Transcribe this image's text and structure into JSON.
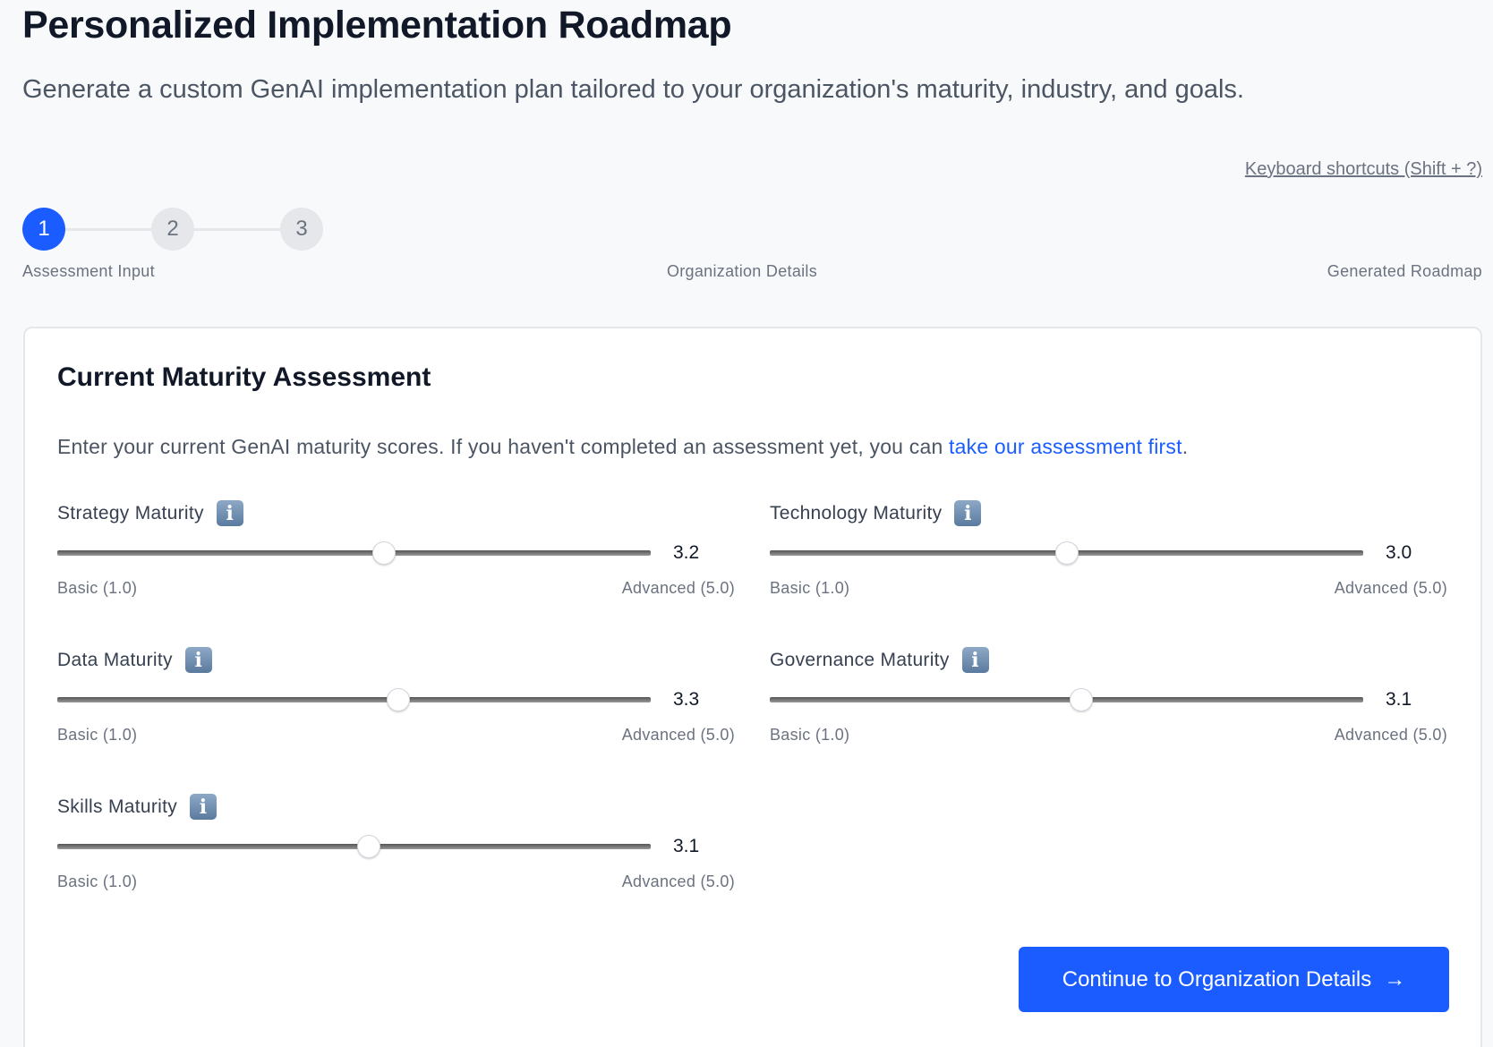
{
  "header": {
    "title": "Personalized Implementation Roadmap",
    "subtitle": "Generate a custom GenAI implementation plan tailored to your organization's maturity, industry, and goals.",
    "shortcuts_link": "Keyboard shortcuts (Shift + ?)"
  },
  "stepper": {
    "active": 1,
    "steps": [
      {
        "number": "1",
        "label": "Assessment Input"
      },
      {
        "number": "2",
        "label": "Organization Details"
      },
      {
        "number": "3",
        "label": "Generated Roadmap"
      }
    ]
  },
  "card": {
    "title": "Current Maturity Assessment",
    "intro_text": "Enter your current GenAI maturity scores. If you haven't completed an assessment yet, you can ",
    "intro_link": "take our assessment first",
    "intro_end": ".",
    "min_label": "Basic (1.0)",
    "max_label": "Advanced (5.0)",
    "slider_min": 1.0,
    "slider_max": 5.0,
    "sliders": [
      {
        "label": "Strategy Maturity",
        "value": "3.2"
      },
      {
        "label": "Technology Maturity",
        "value": "3.0"
      },
      {
        "label": "Data Maturity",
        "value": "3.3"
      },
      {
        "label": "Governance Maturity",
        "value": "3.1"
      },
      {
        "label": "Skills Maturity",
        "value": "3.1"
      }
    ],
    "continue_button": "Continue to Organization Details",
    "continue_icon": "→"
  },
  "colors": {
    "accent": "#1a5cff",
    "inactive_step": "#e5e7eb"
  }
}
